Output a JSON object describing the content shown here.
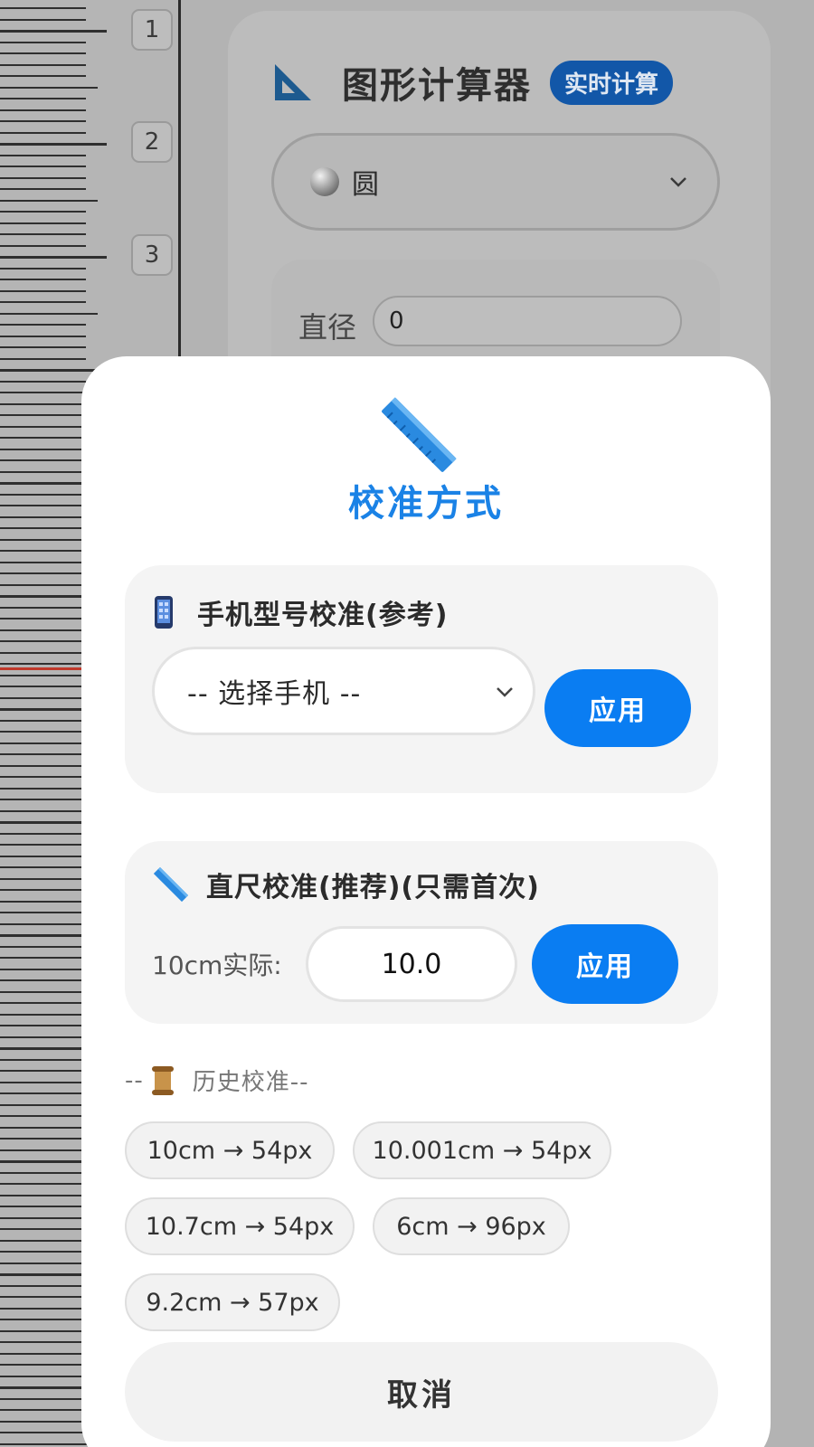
{
  "ruler": {
    "numbers": [
      "1",
      "2",
      "3"
    ]
  },
  "calculator": {
    "title": "图形计算器",
    "badge": "实时计算",
    "shape_select": {
      "icon": "circle-icon",
      "value": "圆"
    },
    "param_label": "直径",
    "param_value": "0"
  },
  "modal": {
    "icon": "ruler-icon",
    "title": "校准方式",
    "phone_section": {
      "icon": "phone-icon",
      "title": "手机型号校准(参考)",
      "select_value": "-- 选择手机 --",
      "apply_label": "应用"
    },
    "ruler_section": {
      "icon": "ruler-icon",
      "title": "直尺校准(推荐)(只需首次)",
      "input_label": "10cm实际:",
      "input_value": "10.0",
      "apply_label": "应用"
    },
    "history": {
      "prefix": "--",
      "icon": "scroll-icon",
      "title": "历史校准--",
      "items": [
        "10cm → 54px",
        "10.001cm → 54px",
        "10.7cm → 54px",
        "6cm → 96px",
        "9.2cm → 57px"
      ]
    },
    "cancel_label": "取消"
  },
  "colors": {
    "accent": "#0a7df2",
    "title_blue": "#1a82e6",
    "badge_blue": "#1257a8",
    "ruler_red": "#c0392b"
  }
}
